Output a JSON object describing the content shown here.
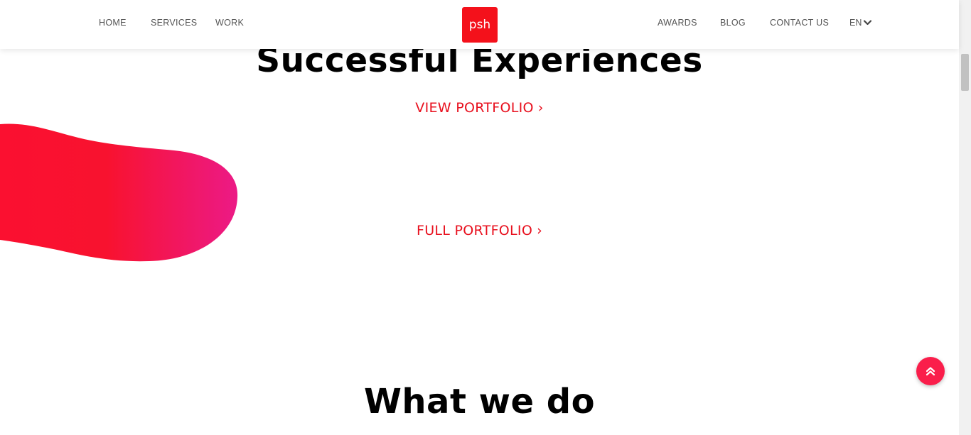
{
  "nav": {
    "left": [
      {
        "label": "HOME"
      },
      {
        "label": "SERVICES"
      },
      {
        "label": "WORK"
      }
    ],
    "right": [
      {
        "label": "AWARDS"
      },
      {
        "label": "BLOG"
      },
      {
        "label": "CONTACT US"
      }
    ],
    "language": "EN",
    "logo_text": "psh"
  },
  "main": {
    "heading": "Successful Experiences",
    "view_portfolio": "VIEW PORTFOLIO",
    "full_portfolio": "FULL PORTFOLIO",
    "section_heading": "What we do"
  },
  "icons": {
    "chevron": "chevron-right-icon",
    "lang_caret": "chevron-down-icon",
    "back_to_top": "double-chevron-up-icon"
  },
  "colors": {
    "brand_red": "#f4111b",
    "cta_red": "#e8101e",
    "blob_start": "#fb1030",
    "blob_end": "#ec1a86",
    "to_top": "#fa1e4b"
  }
}
